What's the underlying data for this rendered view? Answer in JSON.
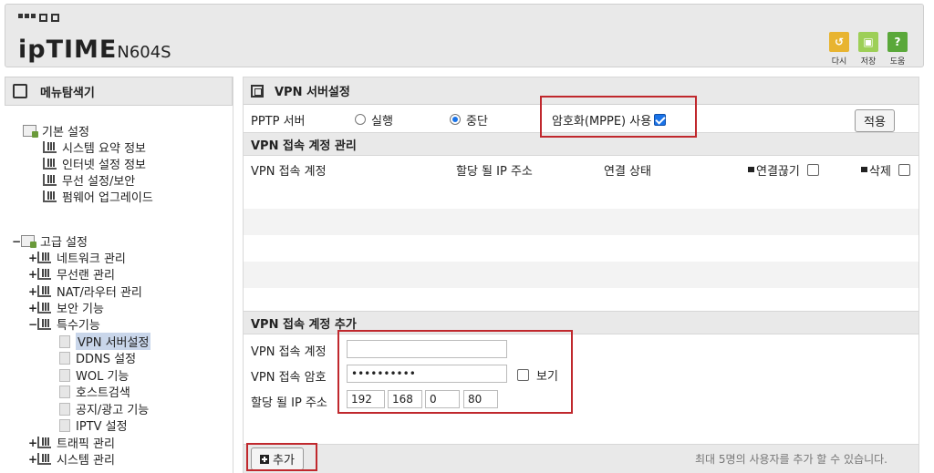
{
  "header": {
    "brand_main": "ipTIME",
    "brand_model": "N604S",
    "buttons": [
      {
        "label": "다시",
        "icon": "refresh-icon"
      },
      {
        "label": "저장",
        "icon": "save-icon"
      },
      {
        "label": "도움",
        "icon": "help-icon"
      }
    ]
  },
  "sidebar": {
    "title": "메뉴탐색기",
    "basic": {
      "label": "기본 설정",
      "items": [
        "시스템 요약 정보",
        "인터넷 설정 정보",
        "무선 설정/보안",
        "펌웨어 업그레이드"
      ]
    },
    "advanced": {
      "label": "고급 설정",
      "items": [
        "네트워크 관리",
        "무선랜 관리",
        "NAT/라우터 관리",
        "보안 기능"
      ],
      "special": {
        "label": "특수기능",
        "items": [
          "VPN 서버설정",
          "DDNS 설정",
          "WOL 기능",
          "호스트검색",
          "공지/광고 기능",
          "IPTV 설정"
        ]
      },
      "after_items": [
        "트래픽 관리",
        "시스템 관리"
      ]
    }
  },
  "main": {
    "title": "VPN 서버설정",
    "pptp": {
      "label": "PPTP 서버",
      "option_run": "실행",
      "option_stop": "중단",
      "selected": "중단",
      "encrypt_label": "암호화(MPPE) 사용",
      "encrypt_checked": true,
      "apply": "적용"
    },
    "accounts": {
      "title": "VPN 접속 계정 관리",
      "columns": [
        "VPN 접속 계정",
        "할당 될 IP 주소",
        "연결 상태",
        "연결끊기",
        "삭제"
      ]
    },
    "add": {
      "title": "VPN 접속 계정 추가",
      "account_label": "VPN 접속 계정",
      "account_value": "",
      "password_label": "VPN 접속 암호",
      "password_value": "••••••••••",
      "show_label": "보기",
      "ip_label": "할당 될 IP 주소",
      "ip": [
        "192",
        "168",
        "0",
        "80"
      ],
      "add_button": "추가",
      "note": "최대 5명의 사용자를 추가 할 수 있습니다."
    }
  }
}
